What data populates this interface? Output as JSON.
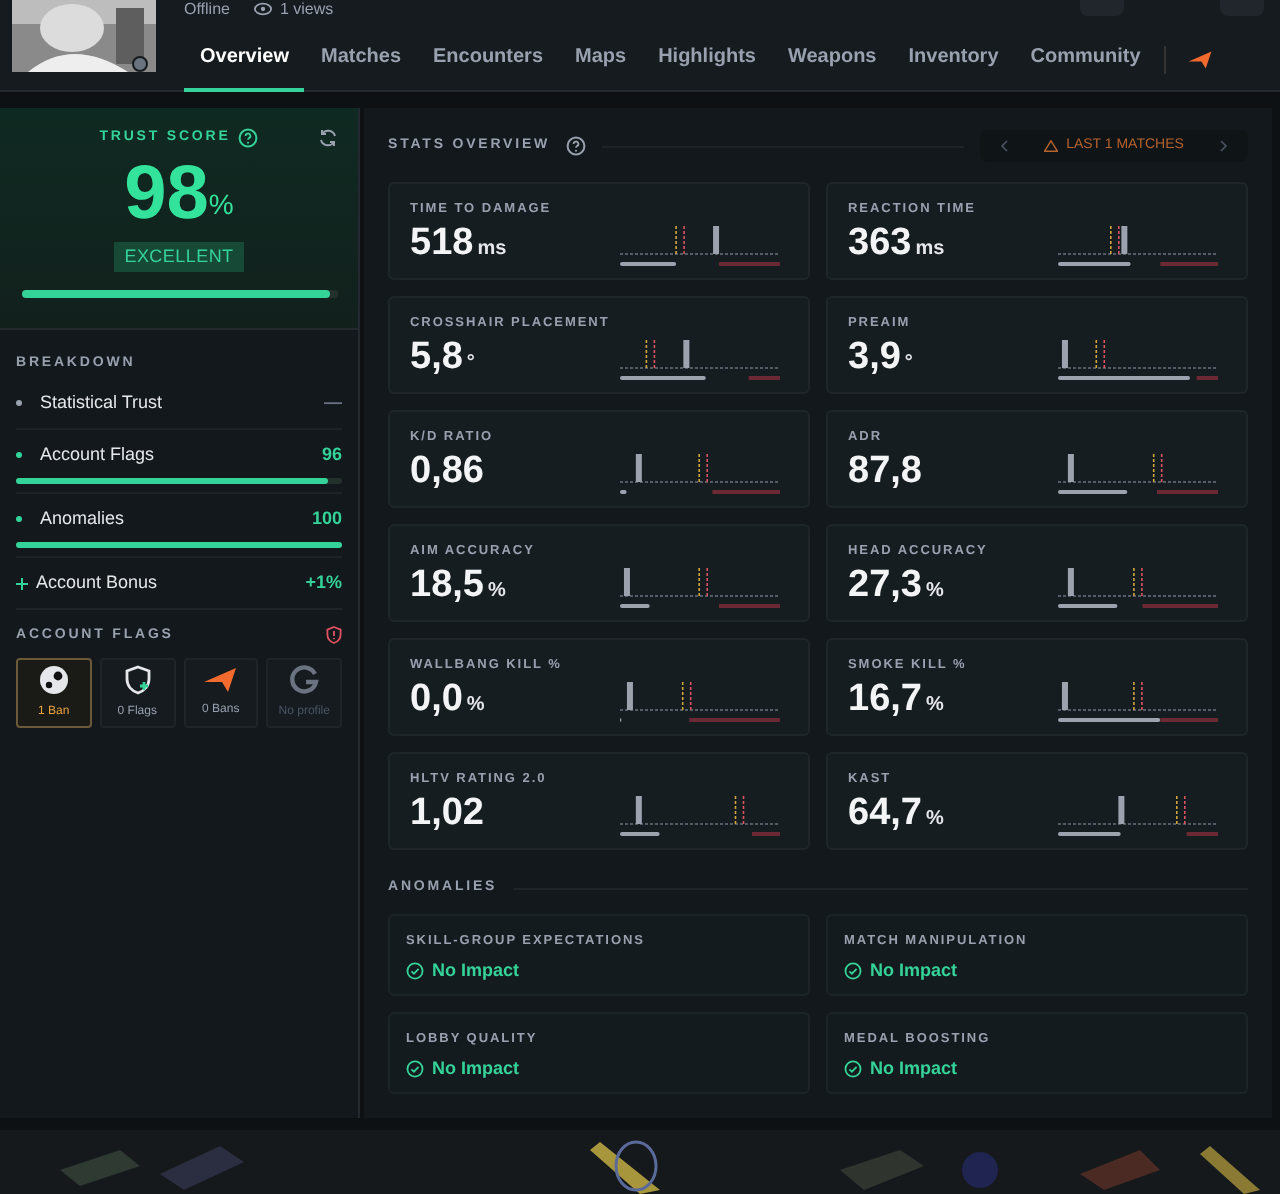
{
  "profile": {
    "status": "Offline",
    "views": "1 views"
  },
  "tabs": [
    {
      "label": "Overview",
      "selected": true
    },
    {
      "label": "Matches",
      "selected": false
    },
    {
      "label": "Encounters",
      "selected": false
    },
    {
      "label": "Maps",
      "selected": false
    },
    {
      "label": "Highlights",
      "selected": false
    },
    {
      "label": "Weapons",
      "selected": false
    },
    {
      "label": "Inventory",
      "selected": false
    },
    {
      "label": "Community",
      "selected": false
    }
  ],
  "trust": {
    "title": "TRUST SCORE",
    "score": "98",
    "unit": "%",
    "rating": "EXCELLENT",
    "level": 0.98
  },
  "breakdown": {
    "title": "BREAKDOWN",
    "items": [
      {
        "kind": "dot",
        "label": "Statistical Trust",
        "value": "—",
        "active": false
      },
      {
        "kind": "bar",
        "label": "Account Flags",
        "value": "96",
        "level": 0.96
      },
      {
        "kind": "bar",
        "label": "Anomalies",
        "value": "100",
        "level": 1.0
      },
      {
        "kind": "plus",
        "label": "Account Bonus",
        "value": "+1%"
      }
    ]
  },
  "account_flags": {
    "title": "ACCOUNT FLAGS",
    "tiles": [
      {
        "kind": "steam",
        "label": "1 Ban",
        "alert": true
      },
      {
        "kind": "shield",
        "label": "0 Flags",
        "alert": false
      },
      {
        "kind": "wing",
        "label": "0 Bans",
        "alert": false
      },
      {
        "kind": "ring",
        "label": "No profile",
        "alert": false
      }
    ]
  },
  "stats": {
    "title": "STATS OVERVIEW",
    "range": "LAST 1 MATCHES",
    "items": [
      {
        "label": "TIME TO DAMAGE",
        "value": "518",
        "unit": "ms"
      },
      {
        "label": "REACTION TIME",
        "value": "363",
        "unit": "ms"
      },
      {
        "label": "CROSSHAIR PLACEMENT",
        "value": "5,8",
        "unit": "°"
      },
      {
        "label": "PREAIM",
        "value": "3,9",
        "unit": "°"
      },
      {
        "label": "K/D RATIO",
        "value": "0,86"
      },
      {
        "label": "ADR",
        "value": "87,8"
      },
      {
        "label": "AIM ACCURACY",
        "value": "18,5",
        "unit": "%"
      },
      {
        "label": "HEAD ACCURACY",
        "value": "27,3",
        "unit": "%"
      },
      {
        "label": "WALLBANG KILL %",
        "value": "0,0",
        "unit": "%"
      },
      {
        "label": "SMOKE KILL %",
        "value": "16,7",
        "unit": "%"
      },
      {
        "label": "HLTV RATING 2.0",
        "value": "1,02"
      },
      {
        "label": "KAST",
        "value": "64,7",
        "unit": "%"
      }
    ]
  },
  "anomalies": {
    "title": "ANOMALIES",
    "items": [
      {
        "label": "SKILL-GROUP EXPECTATIONS",
        "status": "No Impact"
      },
      {
        "label": "MATCH MANIPULATION",
        "status": "No Impact"
      },
      {
        "label": "LOBBY QUALITY",
        "status": "No Impact"
      },
      {
        "label": "MEDAL BOOSTING",
        "status": "No Impact"
      }
    ]
  }
}
